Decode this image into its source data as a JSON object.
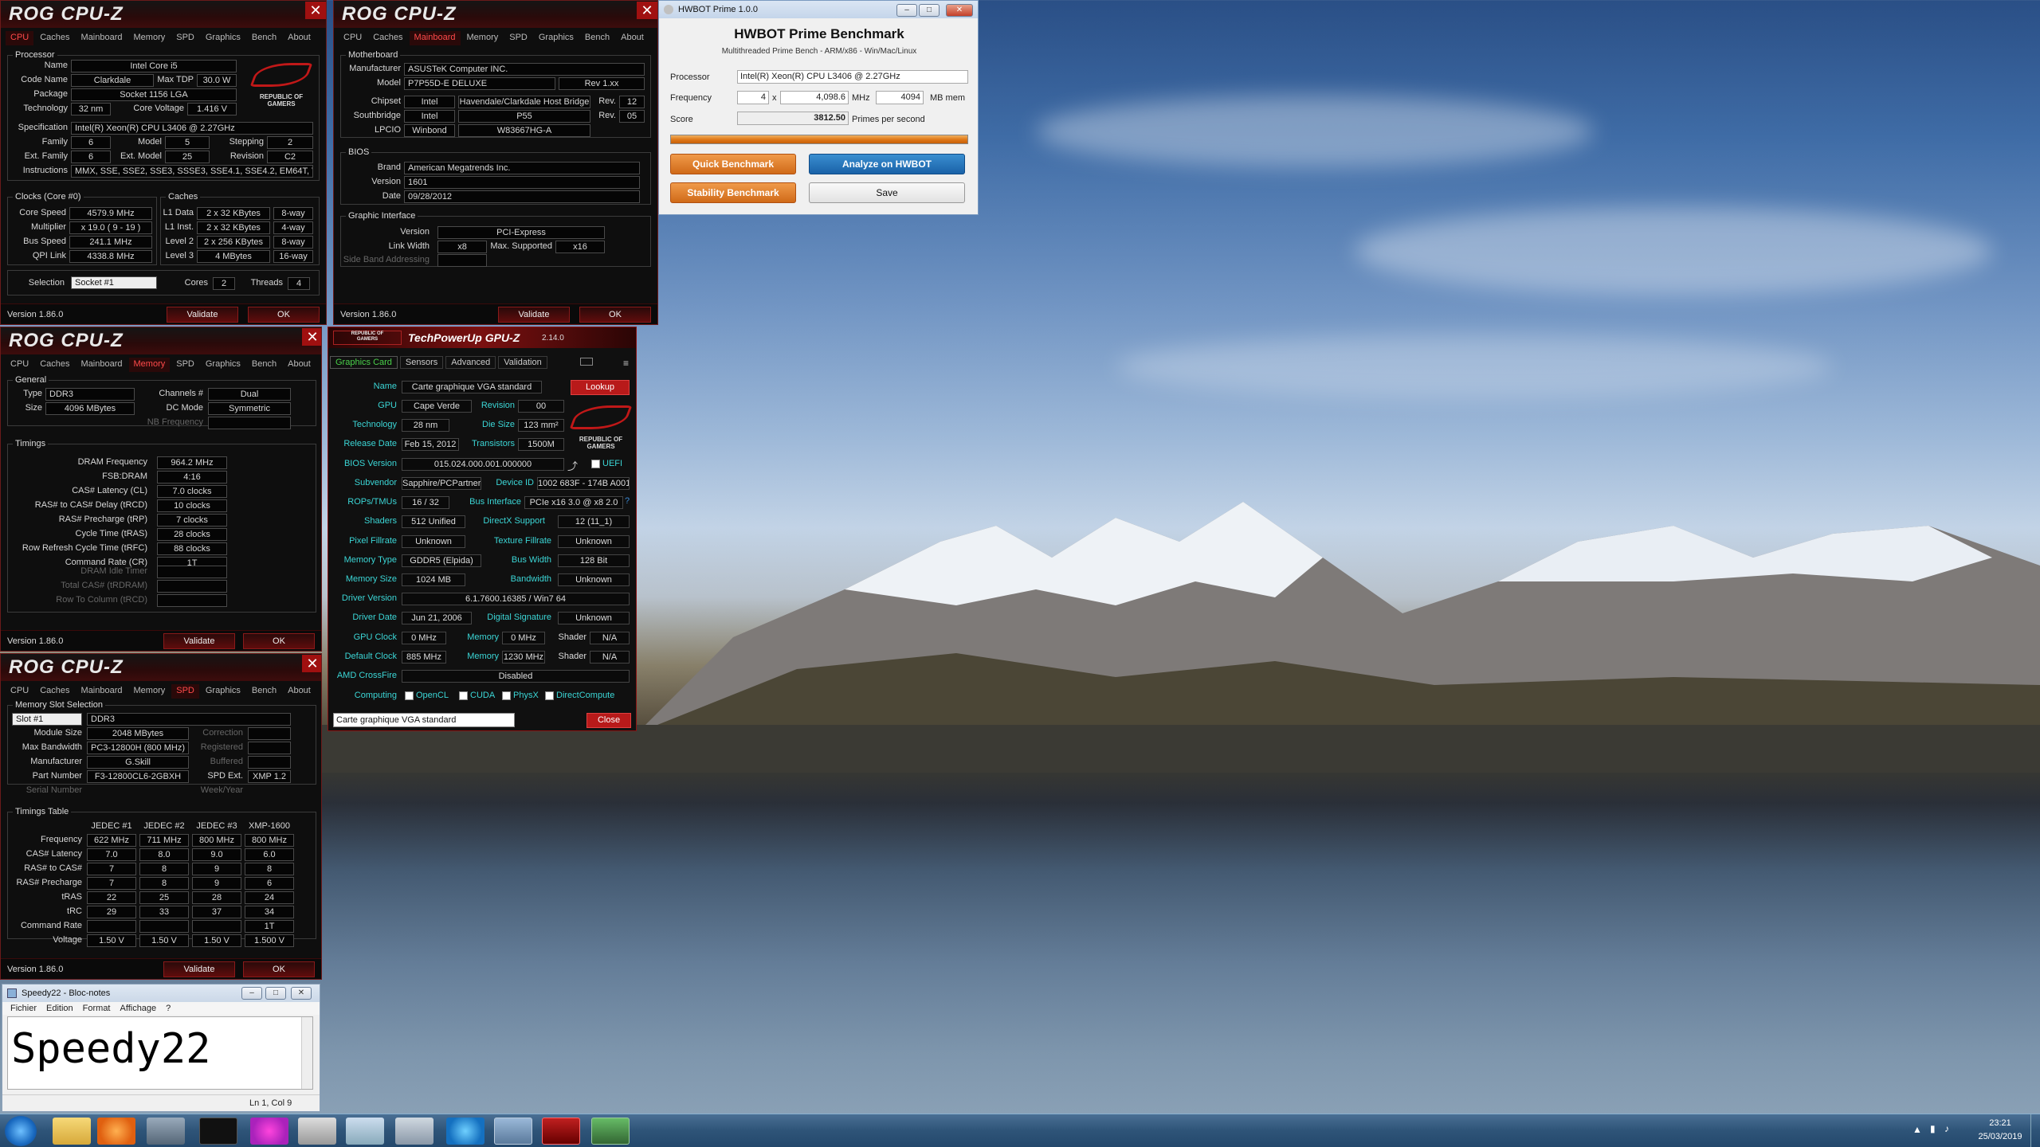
{
  "cpuz_tabs": [
    "CPU",
    "Caches",
    "Mainboard",
    "Memory",
    "SPD",
    "Graphics",
    "Bench",
    "About"
  ],
  "rog_logo": "ROG CPU-Z",
  "rog_mark_text": "REPUBLIC OF\nGAMERS",
  "version": "Version 1.86.0",
  "validate": "Validate",
  "ok": "OK",
  "close_x": "✕",
  "cpu": {
    "grp_processor": "Processor",
    "name_l": "Name",
    "name": "Intel Core i5",
    "code_l": "Code Name",
    "code": "Clarkdale",
    "tdp_l": "Max TDP",
    "tdp": "30.0 W",
    "pkg_l": "Package",
    "pkg": "Socket 1156 LGA",
    "tech_l": "Technology",
    "tech": "32 nm",
    "cv_l": "Core Voltage",
    "cv": "1.416 V",
    "spec_l": "Specification",
    "spec": "Intel(R) Xeon(R) CPU        L3406  @ 2.27GHz",
    "fam_l": "Family",
    "fam": "6",
    "mod_l": "Model",
    "mod": "5",
    "step_l": "Stepping",
    "step": "2",
    "efam_l": "Ext. Family",
    "efam": "6",
    "emod_l": "Ext. Model",
    "emod": "25",
    "rev_l": "Revision",
    "rev": "C2",
    "inst_l": "Instructions",
    "inst": "MMX, SSE, SSE2, SSE3, SSSE3, SSE4.1, SSE4.2, EM64T, VT-x",
    "grp_clocks": "Clocks (Core #0)",
    "grp_caches": "Caches",
    "cs_l": "Core Speed",
    "cs": "4579.9 MHz",
    "mul_l": "Multiplier",
    "mul": "x 19.0 ( 9 - 19 )",
    "bus_l": "Bus Speed",
    "bus": "241.1 MHz",
    "qpi_l": "QPI Link",
    "qpi": "4338.8 MHz",
    "l1d_l": "L1 Data",
    "l1d": "2 x 32 KBytes",
    "l1d_w": "8-way",
    "l1i_l": "L1 Inst.",
    "l1i": "2 x 32 KBytes",
    "l1i_w": "4-way",
    "l2_l": "Level 2",
    "l2": "2 x 256 KBytes",
    "l2_w": "8-way",
    "l3_l": "Level 3",
    "l3": "4 MBytes",
    "l3_w": "16-way",
    "sel_l": "Selection",
    "sel": "Socket #1",
    "cores_l": "Cores",
    "cores": "2",
    "thr_l": "Threads",
    "thr": "4"
  },
  "mb": {
    "grp": "Motherboard",
    "man_l": "Manufacturer",
    "man": "ASUSTeK Computer INC.",
    "model_l": "Model",
    "model": "P7P55D-E DELUXE",
    "model_rev": "Rev 1.xx",
    "chip_l": "Chipset",
    "chip_v": "Intel",
    "chip": "Havendale/Clarkdale Host Bridge",
    "chip_rev_l": "Rev.",
    "chip_rev": "12",
    "sb_l": "Southbridge",
    "sb_v": "Intel",
    "sb": "P55",
    "sb_rev_l": "Rev.",
    "sb_rev": "05",
    "lpc_l": "LPCIO",
    "lpc_v": "Winbond",
    "lpc": "W83667HG-A",
    "grp_bios": "BIOS",
    "brand_l": "Brand",
    "brand": "American Megatrends Inc.",
    "bver_l": "Version",
    "bver": "1601",
    "bdate_l": "Date",
    "bdate": "09/28/2012",
    "grp_gi": "Graphic Interface",
    "gver_l": "Version",
    "gver": "PCI-Express",
    "lw_l": "Link Width",
    "lw": "x8",
    "ms_l": "Max. Supported",
    "ms": "x16",
    "sba_l": "Side Band Addressing"
  },
  "mem": {
    "grp": "General",
    "type_l": "Type",
    "type": "DDR3",
    "ch_l": "Channels #",
    "ch": "Dual",
    "size_l": "Size",
    "size": "4096 MBytes",
    "dc_l": "DC Mode",
    "dc": "Symmetric",
    "nb_l": "NB Frequency",
    "grp_t": "Timings",
    "rows": [
      [
        "DRAM Frequency",
        "964.2 MHz"
      ],
      [
        "FSB:DRAM",
        "4:16"
      ],
      [
        "CAS# Latency (CL)",
        "7.0 clocks"
      ],
      [
        "RAS# to CAS# Delay (tRCD)",
        "10 clocks"
      ],
      [
        "RAS# Precharge (tRP)",
        "7 clocks"
      ],
      [
        "Cycle Time (tRAS)",
        "28 clocks"
      ],
      [
        "Row Refresh Cycle Time (tRFC)",
        "88 clocks"
      ],
      [
        "Command Rate (CR)",
        "1T"
      ]
    ],
    "dim": [
      "DRAM Idle Timer",
      "Total CAS# (tRDRAM)",
      "Row To Column (tRCD)"
    ]
  },
  "spd": {
    "grp": "Memory Slot Selection",
    "slot": "Slot #1",
    "slot_type": "DDR3",
    "ms_l": "Module Size",
    "ms": "2048 MBytes",
    "corr_l": "Correction",
    "mb_l": "Max Bandwidth",
    "mb": "PC3-12800H (800 MHz)",
    "reg_l": "Registered",
    "man_l": "Manufacturer",
    "man": "G.Skill",
    "buf_l": "Buffered",
    "pn_l": "Part Number",
    "pn": "F3-12800CL6-2GBXH",
    "spdext_l": "SPD Ext.",
    "spdext": "XMP 1.2",
    "sn_l": "Serial Number",
    "wy_l": "Week/Year",
    "grp_t": "Timings Table",
    "cols": [
      "JEDEC #1",
      "JEDEC #2",
      "JEDEC #3",
      "XMP-1600"
    ],
    "rows": [
      [
        "Frequency",
        "622 MHz",
        "711 MHz",
        "800 MHz",
        "800 MHz"
      ],
      [
        "CAS# Latency",
        "7.0",
        "8.0",
        "9.0",
        "6.0"
      ],
      [
        "RAS# to CAS#",
        "7",
        "8",
        "9",
        "8"
      ],
      [
        "RAS# Precharge",
        "7",
        "8",
        "9",
        "6"
      ],
      [
        "tRAS",
        "22",
        "25",
        "28",
        "24"
      ],
      [
        "tRC",
        "29",
        "33",
        "37",
        "34"
      ],
      [
        "Command Rate",
        "",
        "",
        "",
        "1T"
      ],
      [
        "Voltage",
        "1.50 V",
        "1.50 V",
        "1.50 V",
        "1.500 V"
      ]
    ]
  },
  "gpuz": {
    "title": "TechPowerUp GPU-Z",
    "ver": "2.14.0",
    "rog_small": "REPUBLIC OF\nGAMERS",
    "tabs": [
      "Graphics Card",
      "Sensors",
      "Advanced",
      "Validation"
    ],
    "name_l": "Name",
    "name": "Carte graphique VGA standard",
    "lookup": "Lookup",
    "gpu_l": "GPU",
    "gpu": "Cape Verde",
    "rev_l": "Revision",
    "rev": "00",
    "tech_l": "Technology",
    "tech": "28 nm",
    "die_l": "Die Size",
    "die": "123 mm²",
    "rd_l": "Release Date",
    "rd": "Feb 15, 2012",
    "tr_l": "Transistors",
    "tr": "1500M",
    "bios_l": "BIOS Version",
    "bios": "015.024.000.001.000000",
    "uefi": "UEFI",
    "sub_l": "Subvendor",
    "sub": "Sapphire/PCPartner",
    "dev_l": "Device ID",
    "dev": "1002 683F - 174B A001",
    "rops_l": "ROPs/TMUs",
    "rops": "16 / 32",
    "bi_l": "Bus Interface",
    "bi": "PCIe x16 3.0 @ x8 2.0",
    "sh_l": "Shaders",
    "sh": "512 Unified",
    "dx_l": "DirectX Support",
    "dx": "12 (11_1)",
    "pf_l": "Pixel Fillrate",
    "pf": "Unknown",
    "tf_l": "Texture Fillrate",
    "tf": "Unknown",
    "mt_l": "Memory Type",
    "mt": "GDDR5 (Elpida)",
    "bw_l": "Bus Width",
    "bw": "128 Bit",
    "msz_l": "Memory Size",
    "msz": "1024 MB",
    "band_l": "Bandwidth",
    "band": "Unknown",
    "dv_l": "Driver Version",
    "dv": "6.1.7600.16385 / Win7 64",
    "dd_l": "Driver Date",
    "dd": "Jun 21, 2006",
    "ds_l": "Digital Signature",
    "ds": "Unknown",
    "gc_l": "GPU Clock",
    "gc": "0 MHz",
    "mem_l": "Memory",
    "gcm": "0 MHz",
    "shd_l": "Shader",
    "gcs": "N/A",
    "dc_l": "Default Clock",
    "dc": "885 MHz",
    "dcm": "1230 MHz",
    "dcs": "N/A",
    "cf_l": "AMD CrossFire",
    "cf": "Disabled",
    "comp_l": "Computing",
    "opencl": "OpenCL",
    "cuda": "CUDA",
    "physx": "PhysX",
    "dcomp": "DirectCompute",
    "sel": "Carte graphique VGA standard",
    "close": "Close"
  },
  "hwbot": {
    "title": "HWBOT Prime 1.0.0",
    "head": "HWBOT Prime Benchmark",
    "sub": "Multithreaded Prime Bench - ARM/x86 - Win/Mac/Linux",
    "proc_l": "Processor",
    "proc": "Intel(R) Xeon(R) CPU        L3406  @ 2.27GHz",
    "freq_l": "Frequency",
    "threads": "4",
    "x": "x",
    "freq": "4,098.6",
    "mhz": "MHz",
    "mem": "4094",
    "memmb": "MB mem",
    "score_l": "Score",
    "score": "3812.50",
    "pps": "Primes per second",
    "quick": "Quick Benchmark",
    "analyze": "Analyze on HWBOT",
    "stab": "Stability Benchmark",
    "save": "Save"
  },
  "notepad": {
    "title": "Speedy22 - Bloc-notes",
    "menus": [
      "Fichier",
      "Edition",
      "Format",
      "Affichage",
      "?"
    ],
    "text": "Speedy22",
    "status": "Ln 1, Col 9"
  },
  "tray": {
    "time": "23:21",
    "date": "25/03/2019"
  }
}
